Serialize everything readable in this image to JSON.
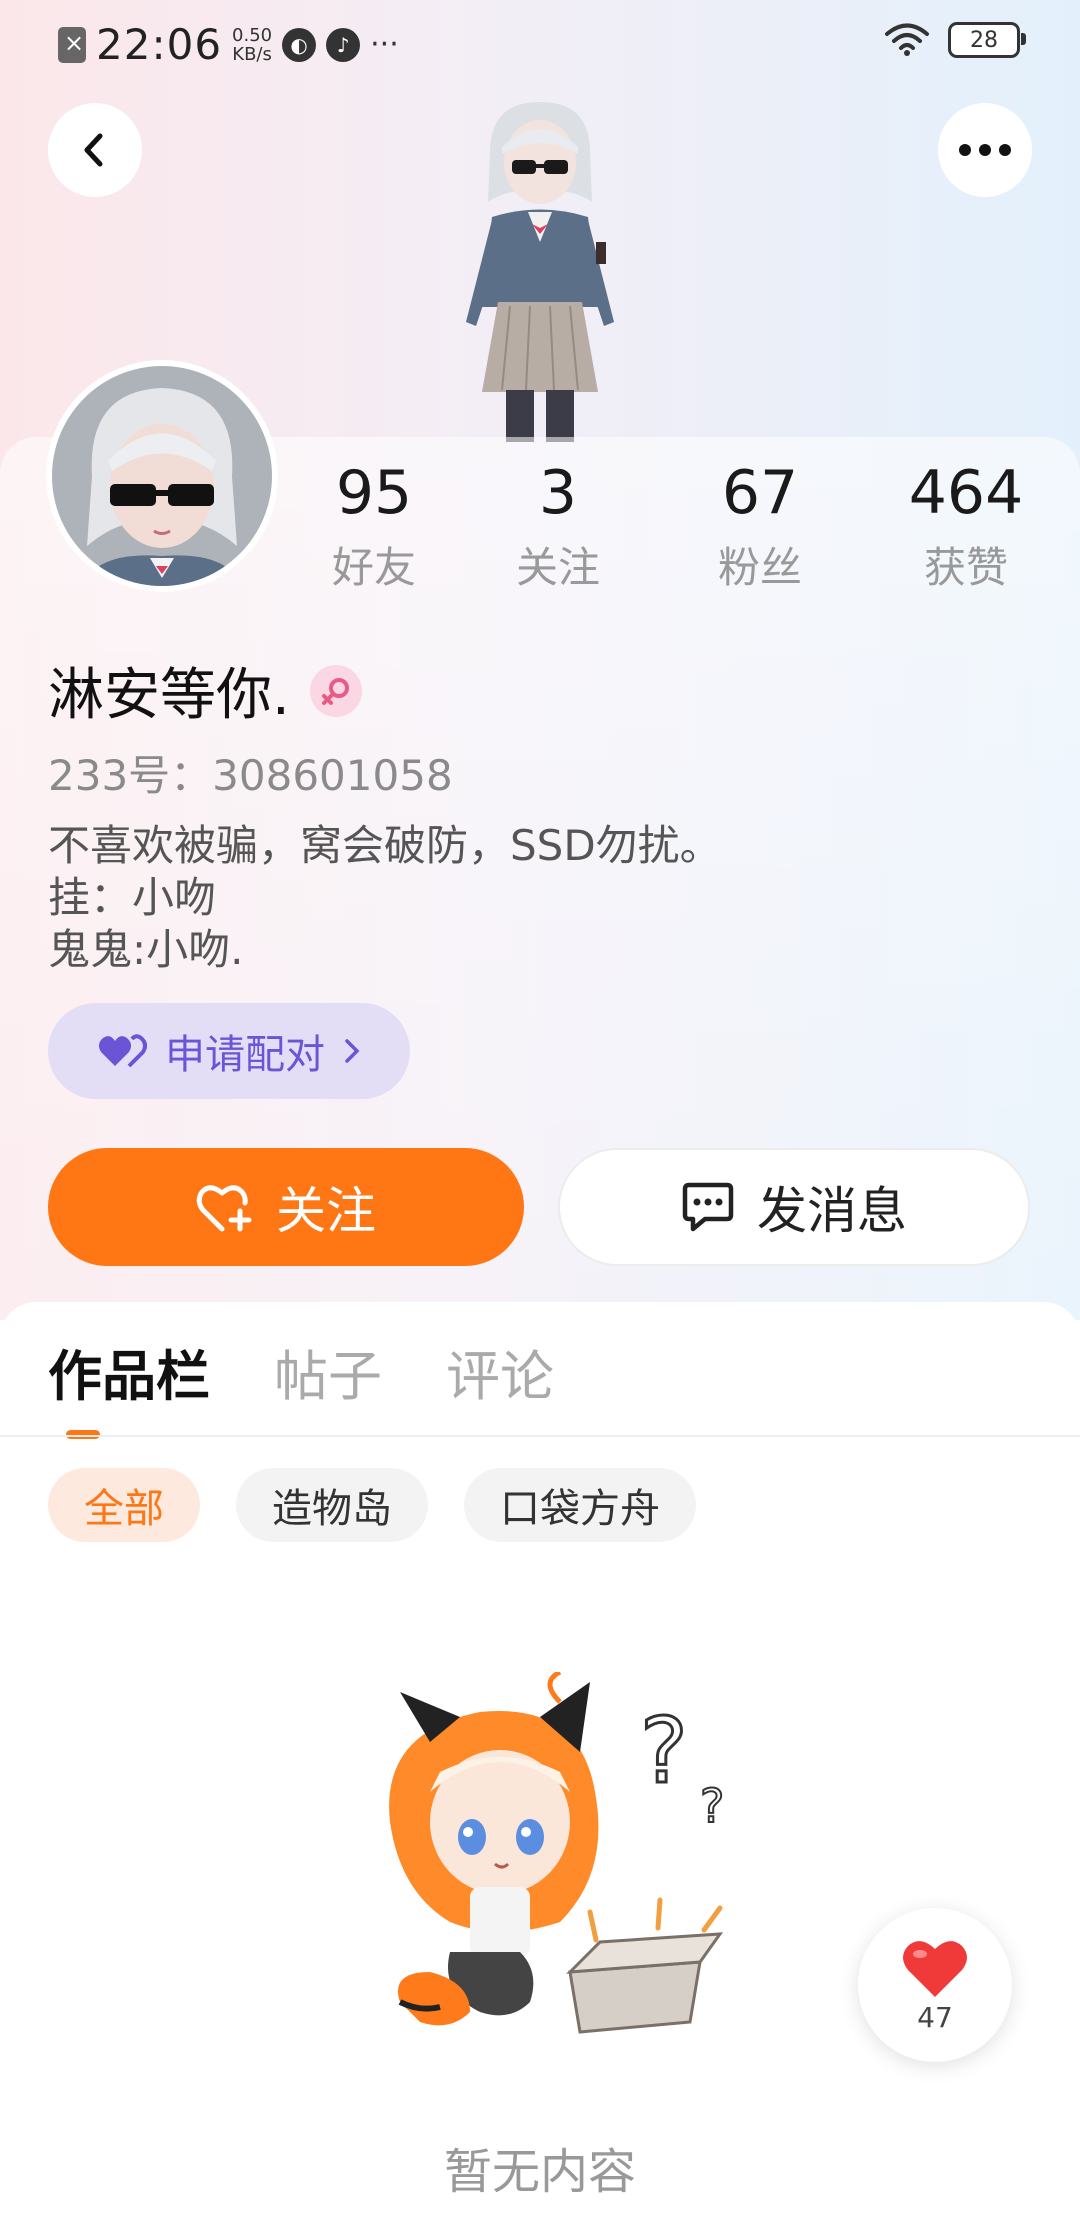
{
  "status_bar": {
    "time": "22:06",
    "net_speed_value": "0.50",
    "net_speed_unit": "KB/s",
    "dots": "···",
    "battery": "28"
  },
  "profile": {
    "stats": [
      {
        "value": "95",
        "label": "好友"
      },
      {
        "value": "3",
        "label": "关注"
      },
      {
        "value": "67",
        "label": "粉丝"
      },
      {
        "value": "464",
        "label": "获赞"
      }
    ],
    "username": "淋安等你.",
    "account_id": "233号：308601058",
    "bio_lines": [
      "不喜欢被骗，窝会破防，SSD勿扰。",
      "挂：小吻",
      "鬼鬼:小吻."
    ],
    "pair_label": "申请配对",
    "follow_label": "关注",
    "message_label": "发消息"
  },
  "tabs": [
    {
      "label": "作品栏",
      "active": true
    },
    {
      "label": "帖子",
      "active": false
    },
    {
      "label": "评论",
      "active": false
    }
  ],
  "chips": [
    {
      "label": "全部",
      "active": true
    },
    {
      "label": "造物岛",
      "active": false
    },
    {
      "label": "口袋方舟",
      "active": false
    }
  ],
  "empty_state": {
    "text": "暂无内容"
  },
  "like_float": {
    "count": "47"
  },
  "colors": {
    "accent": "#ff7614",
    "pair_text": "#6b55d6",
    "pair_bg": "#e3def6"
  }
}
